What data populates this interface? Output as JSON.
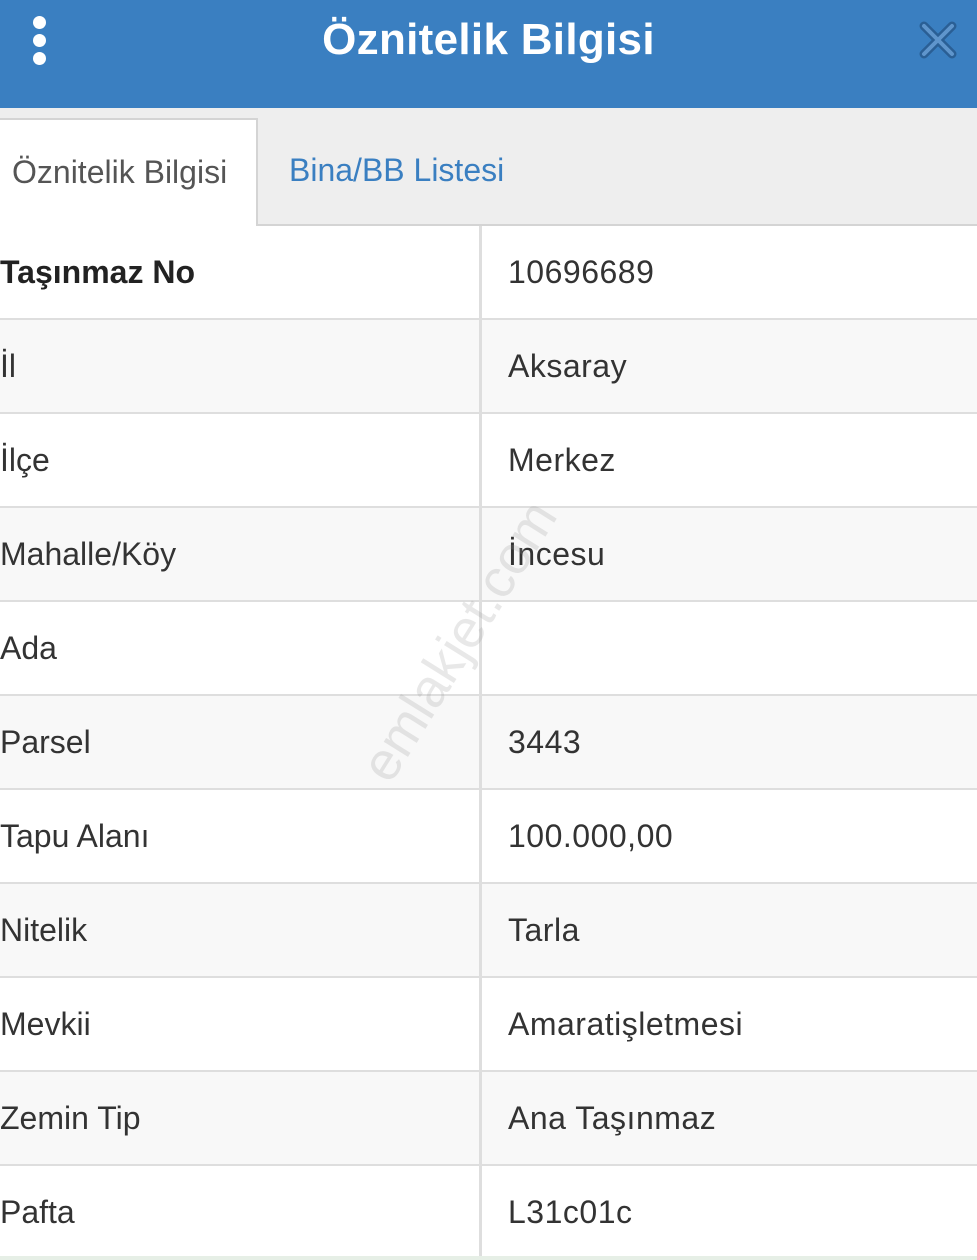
{
  "header": {
    "title": "Öznitelik Bilgisi",
    "menu_icon": "vertical-dots-icon",
    "close_icon": "close-icon",
    "color": "#3a7fc1"
  },
  "tabs": [
    {
      "label": "Öznitelik Bilgisi",
      "active": true
    },
    {
      "label": "Bina/BB Listesi",
      "active": false
    }
  ],
  "rows": [
    {
      "label": "Taşınmaz No",
      "value": "10696689"
    },
    {
      "label": "İl",
      "value": "Aksaray"
    },
    {
      "label": "İlçe",
      "value": "Merkez"
    },
    {
      "label": "Mahalle/Köy",
      "value": "İncesu"
    },
    {
      "label": "Ada",
      "value": ""
    },
    {
      "label": "Parsel",
      "value": "3443"
    },
    {
      "label": "Tapu Alanı",
      "value": "100.000,00"
    },
    {
      "label": "Nitelik",
      "value": "Tarla"
    },
    {
      "label": "Mevkii",
      "value": "Amaratişletmesi"
    },
    {
      "label": "Zemin Tip",
      "value": "Ana Taşınmaz"
    },
    {
      "label": "Pafta",
      "value": "L31c01c"
    }
  ],
  "watermark": "emlakjet.com"
}
